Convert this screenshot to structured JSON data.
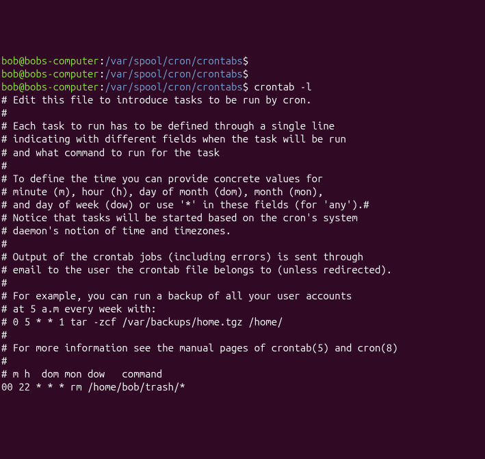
{
  "prompts": [
    {
      "user_host": "bob@bobs-computer",
      "colon": ":",
      "path": "/var/spool/cron/crontabs",
      "dollar": "$",
      "command": ""
    },
    {
      "user_host": "bob@bobs-computer",
      "colon": ":",
      "path": "/var/spool/cron/crontabs",
      "dollar": "$",
      "command": ""
    },
    {
      "user_host": "bob@bobs-computer",
      "colon": ":",
      "path": "/var/spool/cron/crontabs",
      "dollar": "$",
      "command": " crontab -l"
    }
  ],
  "output": [
    "# Edit this file to introduce tasks to be run by cron.",
    "#",
    "# Each task to run has to be defined through a single line",
    "# indicating with different fields when the task will be run",
    "# and what command to run for the task",
    "#",
    "# To define the time you can provide concrete values for",
    "# minute (m), hour (h), day of month (dom), month (mon),",
    "# and day of week (dow) or use '*' in these fields (for 'any').#",
    "# Notice that tasks will be started based on the cron's system",
    "# daemon's notion of time and timezones.",
    "#",
    "# Output of the crontab jobs (including errors) is sent through",
    "# email to the user the crontab file belongs to (unless redirected).",
    "#",
    "# For example, you can run a backup of all your user accounts",
    "# at 5 a.m every week with:",
    "# 0 5 * * 1 tar -zcf /var/backups/home.tgz /home/",
    "#",
    "# For more information see the manual pages of crontab(5) and cron(8)",
    "#",
    "# m h  dom mon dow   command",
    "",
    "00 22 * * * rm /home/bob/trash/*"
  ]
}
